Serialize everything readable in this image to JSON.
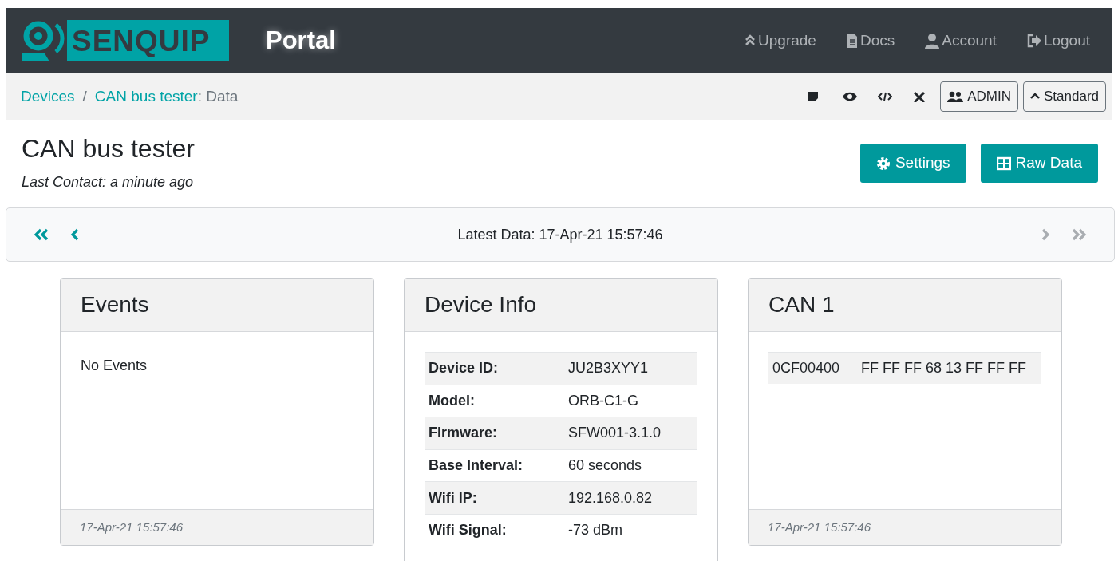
{
  "brand": {
    "logo_text": "SENQUIP",
    "title": "Portal"
  },
  "nav_links": [
    {
      "label": "Upgrade"
    },
    {
      "label": "Docs"
    },
    {
      "label": "Account"
    },
    {
      "label": "Logout"
    }
  ],
  "breadcrumb": {
    "items": [
      {
        "label": "Devices"
      },
      {
        "label": "CAN bus tester"
      }
    ],
    "separator": "/",
    "current": ": Data"
  },
  "toolbar_buttons": [
    {
      "label": "ADMIN"
    },
    {
      "label": "Standard"
    }
  ],
  "page": {
    "title": "CAN bus tester",
    "last_contact": "Last Contact: a minute ago",
    "actions": [
      {
        "label": "Settings"
      },
      {
        "label": "Raw Data"
      }
    ]
  },
  "data_nav": {
    "label": "Latest Data: 17-Apr-21 15:57:46",
    "buttons": [
      {
        "disabled": false
      },
      {
        "disabled": false
      },
      {
        "disabled": true
      },
      {
        "disabled": true
      }
    ]
  },
  "cards": [
    {
      "kind": "text",
      "title": "Events",
      "text": "No Events",
      "footer": "17-Apr-21 15:57:46"
    },
    {
      "kind": "info",
      "title": "Device Info",
      "rows": [
        {
          "label": "Device ID:",
          "value": "JU2B3XYY1"
        },
        {
          "label": "Model:",
          "value": "ORB-C1-G"
        },
        {
          "label": "Firmware:",
          "value": "SFW001-3.1.0"
        },
        {
          "label": "Base Interval:",
          "value": "60 seconds"
        },
        {
          "label": "Wifi IP:",
          "value": "192.168.0.82"
        },
        {
          "label": "Wifi Signal:",
          "value": "-73 dBm"
        }
      ]
    },
    {
      "kind": "can",
      "title": "CAN 1",
      "rows": [
        {
          "id": "0CF00400",
          "data": "FF FF FF 68 13 FF FF FF"
        }
      ],
      "footer": "17-Apr-21 15:57:46"
    }
  ]
}
